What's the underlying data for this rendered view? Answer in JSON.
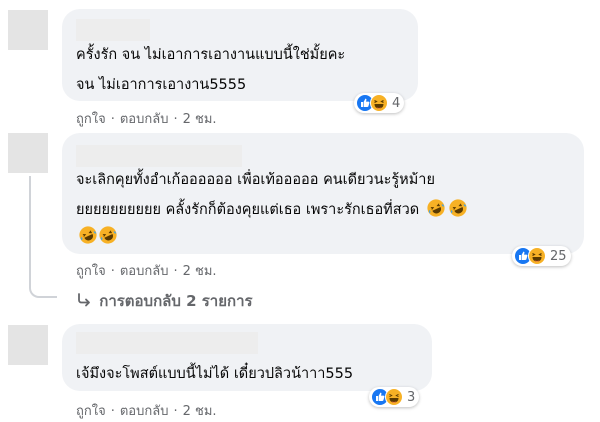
{
  "comments": [
    {
      "lines": [
        "ครั้งรัก จน ไม่เอาการเอางานแบบนี้ใช่มั้ยคะ",
        "จน ไม่เอาการเอางาน5555"
      ],
      "actions": {
        "like": "ถูกใจ",
        "reply": "ตอบกลับ",
        "time": "2 ชม."
      },
      "reaction_count": "4",
      "reaction_icons": [
        "like-icon",
        "laugh-icon"
      ]
    },
    {
      "lines": [
        "จะเลิกคุยทั้งอำเก้ออออออ เพื่อเท้อออออ คนเดียวนะรู้หม้าย",
        "ยยยยยยยยยย คลั้งรักก็ต้องคุยแต่เธอ เพราะรักเธอที่สวด",
        ""
      ],
      "actions": {
        "like": "ถูกใจ",
        "reply": "ตอบกลับ",
        "time": "2 ชม."
      },
      "reaction_count": "25",
      "reaction_icons": [
        "like-icon",
        "laugh-icon"
      ],
      "inline_emojis": [
        "rofl-emoji",
        "rofl-emoji",
        "rofl-emoji"
      ],
      "replies_link": "การตอบกลับ 2 รายการ"
    },
    {
      "lines": [
        "เจ้มึงจะโพสต์แบบนี้ไม่ได้ เดี๋ยวปลิวน้าาา555"
      ],
      "actions": {
        "like": "ถูกใจ",
        "reply": "ตอบกลับ",
        "time": "2 ชม."
      },
      "reaction_count": "3",
      "reaction_icons": [
        "like-icon",
        "laugh-icon"
      ]
    }
  ],
  "separator": "·",
  "colors": {
    "bubble": "#f0f2f5",
    "secondary_text": "#65676b",
    "like_blue": "#1877f2",
    "emoji_yellow": "#f7b125"
  }
}
